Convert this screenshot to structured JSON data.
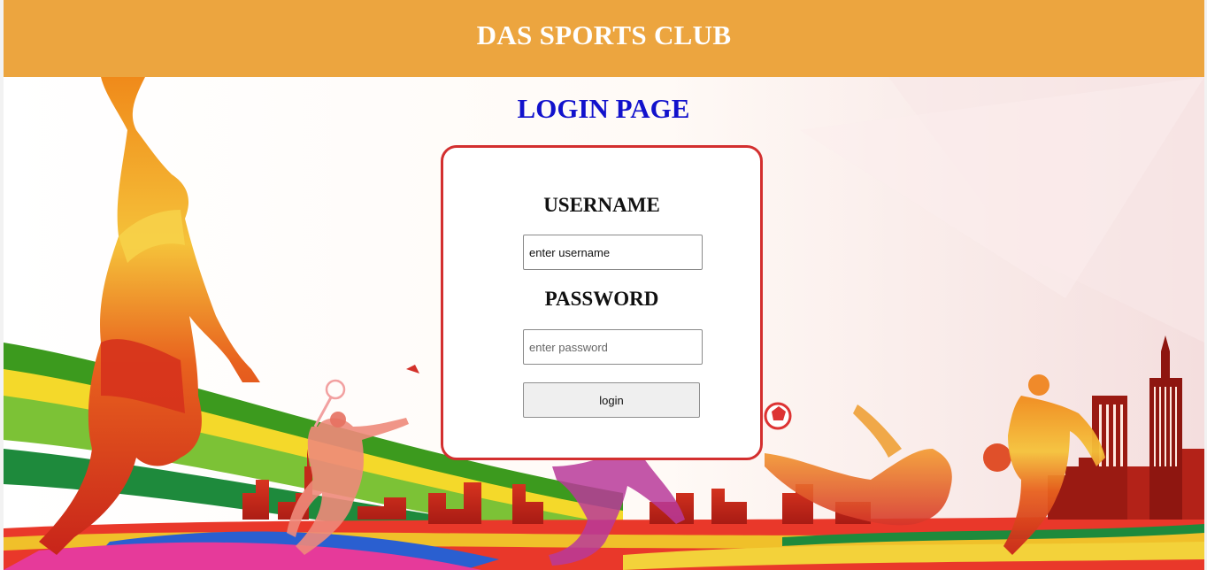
{
  "header": {
    "title": "DAS SPORTS CLUB"
  },
  "main": {
    "title": "LOGIN PAGE"
  },
  "login_form": {
    "username_label": "USERNAME",
    "username_placeholder": "enter username",
    "username_value": "",
    "password_label": "PASSWORD",
    "password_placeholder": "enter password",
    "password_value": "",
    "login_button_label": "login"
  },
  "colors": {
    "header_bg": "#eca53f",
    "title_color": "#1212cc",
    "card_border": "#d32f2f"
  },
  "background": {
    "description_icon": "sports-silhouettes-illustration"
  }
}
